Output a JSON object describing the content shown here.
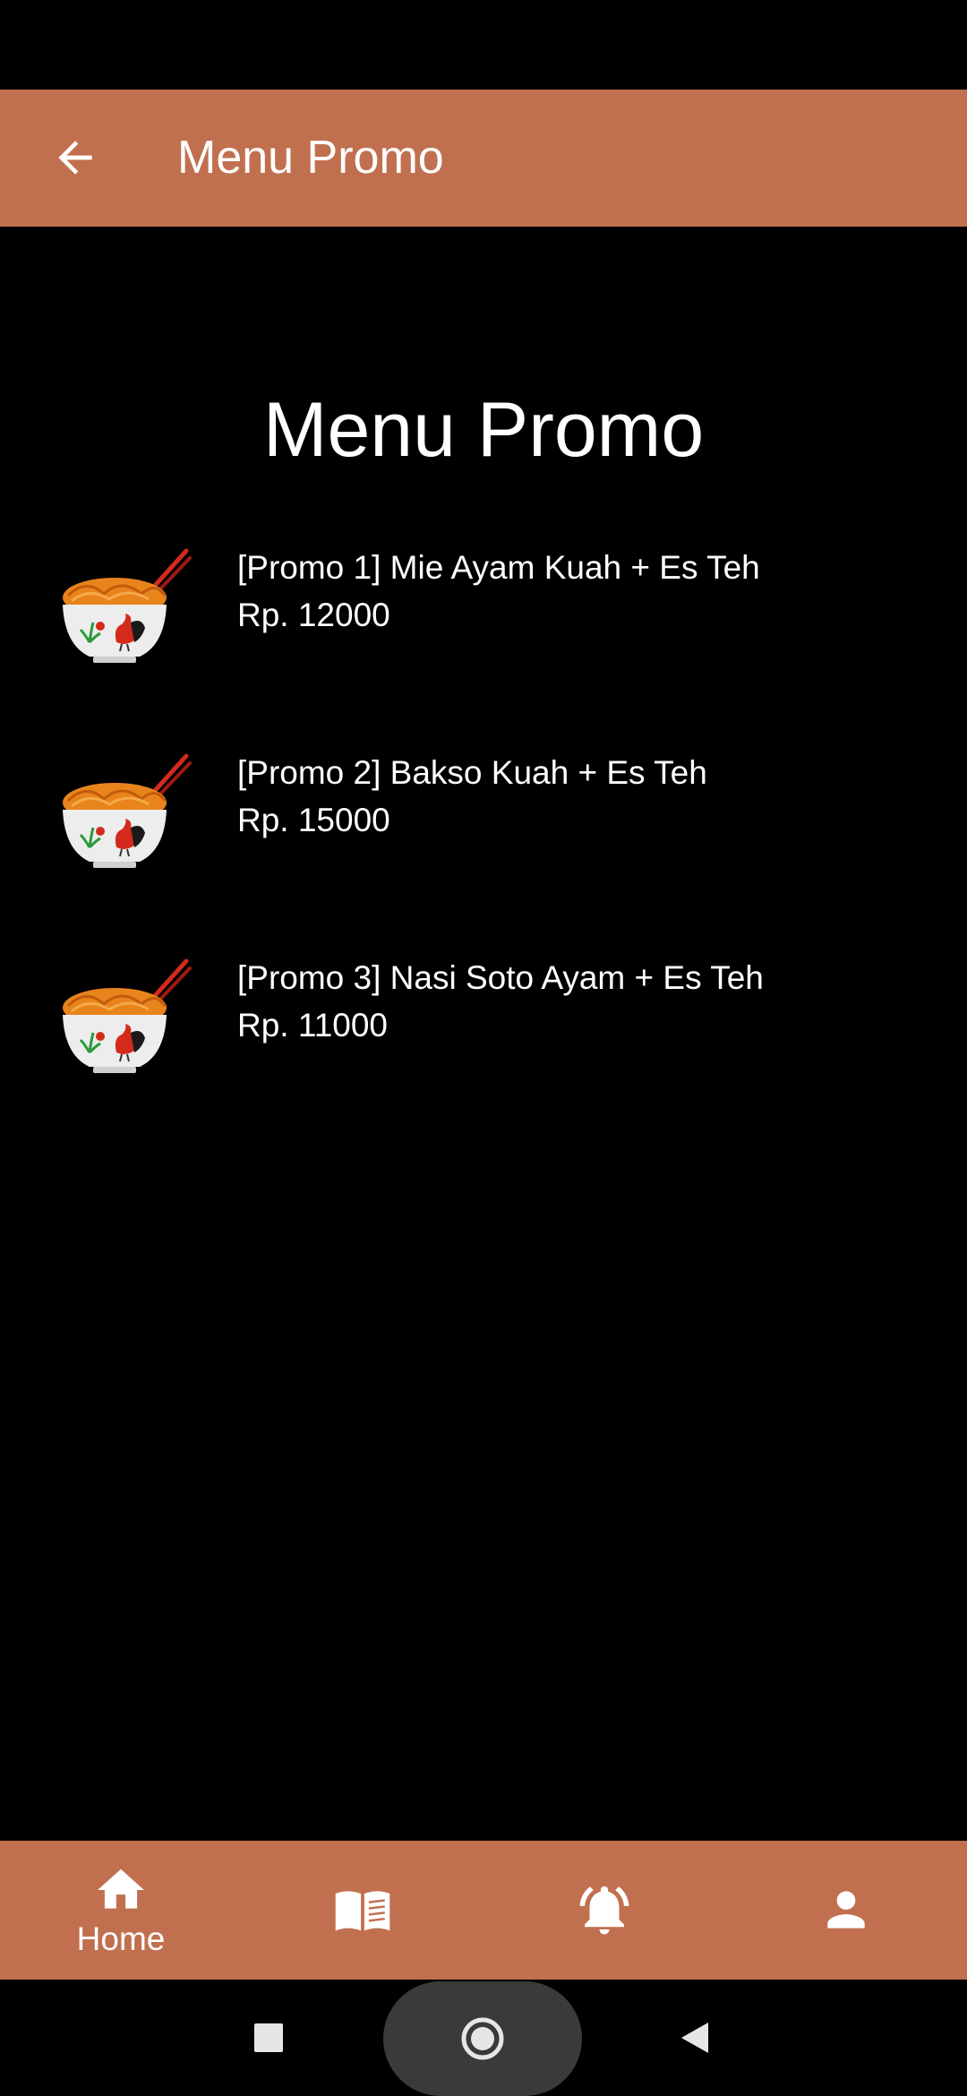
{
  "app_bar": {
    "title": "Menu Promo",
    "back_icon": "arrow-left-icon"
  },
  "page": {
    "heading": "Menu Promo"
  },
  "promos": [
    {
      "name": "[Promo 1] Mie Ayam Kuah + Es Teh",
      "price": "Rp. 12000",
      "icon": "noodle-bowl-icon"
    },
    {
      "name": "[Promo 2] Bakso Kuah + Es Teh",
      "price": "Rp. 15000",
      "icon": "noodle-bowl-icon"
    },
    {
      "name": "[Promo 3] Nasi Soto Ayam + Es Teh",
      "price": "Rp. 11000",
      "icon": "noodle-bowl-icon"
    }
  ],
  "bottom_nav": {
    "items": [
      {
        "label": "Home",
        "icon": "home-icon",
        "active": true
      },
      {
        "label": "",
        "icon": "menu-book-icon",
        "active": false
      },
      {
        "label": "",
        "icon": "notification-bell-icon",
        "active": false
      },
      {
        "label": "",
        "icon": "profile-icon",
        "active": false
      }
    ]
  },
  "system_nav": {
    "icons": [
      "recents-square-icon",
      "home-circle-icon",
      "back-triangle-icon"
    ]
  },
  "colors": {
    "accent": "#c1704f",
    "background": "#000000",
    "text": "#ffffff"
  }
}
